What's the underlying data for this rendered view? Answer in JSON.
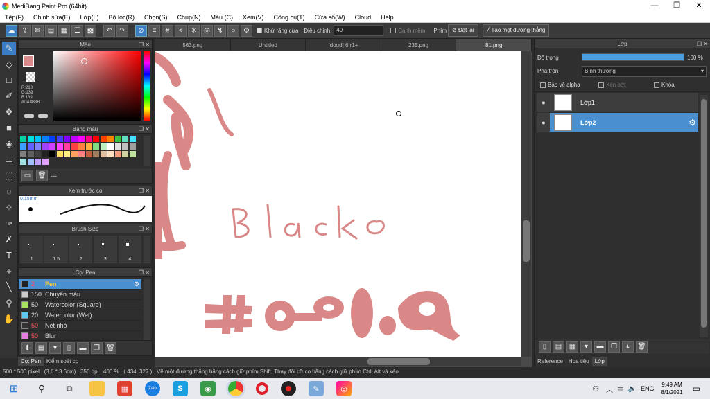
{
  "window": {
    "title": "MediBang Paint Pro (64bit)",
    "min": "—",
    "max": "❐",
    "close": "✕"
  },
  "menu": [
    "Tệp(F)",
    "Chỉnh sửa(E)",
    "Lớp(L)",
    "Bộ lọc(R)",
    "Chọn(S)",
    "Chụp(N)",
    "Màu (C)",
    "Xem(V)",
    "Công cụ(T)",
    "Cửa sổ(W)",
    "Cloud",
    "Help"
  ],
  "toolbar": {
    "antialias": "Khử răng cưa",
    "adjust": "Điều chỉnh",
    "adjust_value": "40",
    "smooth": "Cạnh mềm",
    "key": "Phím",
    "reset": "Đặt lại",
    "straight_line": "Tạo một đường thẳng"
  },
  "color_panel": {
    "title": "Màu",
    "r": "R:218",
    "g": "G:139",
    "b": "B:139",
    "hex": "#DA8B8B",
    "current": "#DA8B8B"
  },
  "palette_panel": {
    "title": "Bảng màu",
    "label": "---"
  },
  "preview_panel": {
    "title": "Xem trước cọ",
    "size": "0.15mm"
  },
  "brushsize_panel": {
    "title": "Brush Size",
    "sizes": [
      "1",
      "1.5",
      "2",
      "3",
      "4"
    ]
  },
  "brush_panel": {
    "title": "Cọ: Pen",
    "items": [
      {
        "size": "2",
        "name": "Pen",
        "color": "#222222"
      },
      {
        "size": "150",
        "name": "Chuyển màu",
        "color": "#cccccc"
      },
      {
        "size": "50",
        "name": "Watercolor (Square)",
        "color": "#a8e060"
      },
      {
        "size": "20",
        "name": "Watercolor (Wet)",
        "color": "#60c8f0"
      },
      {
        "size": "50",
        "name": "Nét nhỏ",
        "color": "#333333"
      },
      {
        "size": "50",
        "name": "Blur",
        "color": "#e080e0"
      }
    ]
  },
  "tabs": [
    {
      "label": "563.png",
      "active": false
    },
    {
      "label": "Untitled",
      "active": false
    },
    {
      "label": "[doud] 6:r1+",
      "active": false
    },
    {
      "label": "235.png",
      "active": false
    },
    {
      "label": "81.png",
      "active": true
    }
  ],
  "canvas_text": "Blacko",
  "layer_panel": {
    "title": "Lớp",
    "opacity_label": "Độ trong",
    "opacity_value": "100 %",
    "opacity": 1.0,
    "blend_label": "Pha trộn",
    "blend_value": "Bình thường",
    "protect_alpha": "Bảo vệ alpha",
    "clip": "Xén bớt",
    "lock": "Khóa",
    "layers": [
      {
        "name": "Lớp1",
        "selected": false
      },
      {
        "name": "Lớp2",
        "selected": true
      }
    ]
  },
  "left_bottom_tabs": [
    "Cọ: Pen",
    "Kiểm soát cọ"
  ],
  "right_bottom_tabs": [
    "Reference",
    "Hoa tiêu",
    "Lớp"
  ],
  "status": {
    "size": "500 * 500 pixel",
    "physical": "(3.6 * 3.6cm)",
    "dpi": "350 dpi",
    "zoom": "400 %",
    "coords": "( 434, 327 )",
    "hint": "Vẽ một đường thẳng bằng cách giữ phím Shift, Thay đổi cỡ cọ bằng cách giữ phím Ctrl, Alt và kéo"
  },
  "taskbar": {
    "lang": "ENG",
    "time": "9:49 AM",
    "date": "8/1/2021"
  },
  "palette_colors": [
    "#00d0a0",
    "#00e0e0",
    "#00c0ff",
    "#0080ff",
    "#0040ff",
    "#4040ff",
    "#8000ff",
    "#c000ff",
    "#ff00ff",
    "#ff0080",
    "#ff0000",
    "#ff4000",
    "#ff8000",
    "#40c040",
    "#60e0c0",
    "#40e0ff",
    "#40a0ff",
    "#6060ff",
    "#8080ff",
    "#a040ff",
    "#d040ff",
    "#ff40ff",
    "#ff40a0",
    "#ff4040",
    "#ff8040",
    "#ffb040",
    "#80e080",
    "#c0f0c0",
    "#ffffff",
    "#e0e0e0",
    "#c0c0c0",
    "#a0a0a0",
    "#808080",
    "#606060",
    "#404040",
    "#202020",
    "#000000",
    "#ffe060",
    "#fff080",
    "#ffa060",
    "#ff8080",
    "#c06040",
    "#a08060",
    "#e0c0a0",
    "#ffe0c0",
    "#f0a080",
    "#d0d0a0",
    "#c0e0a0",
    "#a0e0e0",
    "#a0c0ff",
    "#c0a0ff",
    "#e0a0ff"
  ]
}
